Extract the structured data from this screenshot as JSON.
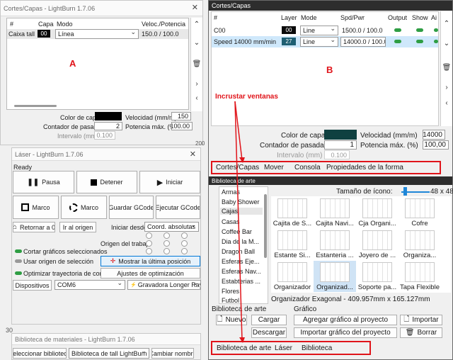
{
  "left": {
    "cuts": {
      "title": "Cortes/Capas - LightBurn 1.7.06",
      "headers": [
        "#",
        "Capa",
        "Modo",
        "Veloc./Potencia"
      ],
      "row": {
        "name": "Caixa tall",
        "layer": "00",
        "mode": "Línea",
        "speed_power": "150.0 / 100.0"
      },
      "marker": "A",
      "layer_color_label": "Color de capa",
      "speed_label": "Velocidad (mm/m)",
      "speed_value": "150",
      "pass_label": "Contador de pasadas",
      "pass_value": "2",
      "power_label": "Potencia máx. (%)",
      "power_value": "100.00",
      "interval_label": "Intervalo (mm)",
      "interval_value": "0.100",
      "ruler_value": "200"
    },
    "laser": {
      "title": "Láser - LightBurn 1.7.06",
      "status": "Ready",
      "buttons": {
        "pause": "Pausa",
        "stop": "Detener",
        "start": "Iniciar",
        "frame1": "Marco",
        "frame2": "Marco",
        "save_gcode": "Guardar GCode",
        "run_gcode": "Ejecutar GCode",
        "home": "Retornar a 0",
        "goto_origin": "Ir al origen",
        "show_last": "Mostrar la última posición",
        "opt_settings": "Ajustes de optimización",
        "devices": "Dispositivos"
      },
      "start_from_label": "Iniciar desde:",
      "start_from_value": "Coord. absolutas",
      "job_origin_label": "Origen del trabajo",
      "cut_selected": "Cortar gráficos seleccionados",
      "use_selection_origin": "Usar origen de selección",
      "optimize_path": "Optimizar trayectoria de corte",
      "port": "COM6",
      "device": "Gravadora Longer Ray"
    },
    "ruler_value": "30",
    "library": {
      "title": "Biblioteca de materiales - LightBurn 1.7.06",
      "select_label": "Seleccionar biblioteca",
      "library_value": "Biblioteca de tall LightBurn",
      "rename_label": "Cambiar nombre"
    }
  },
  "right": {
    "cuts": {
      "title": "Cortes/Capas",
      "headers": [
        "#",
        "Layer",
        "Mode",
        "Spd/Pwr",
        "Output",
        "Show",
        "Ai"
      ],
      "rows": [
        {
          "name": "C00",
          "layer": "00",
          "mode": "Line",
          "spd": "1500.0 / 100.0"
        },
        {
          "name": "Speed 14000 mm/min",
          "layer": "27",
          "mode": "Line",
          "spd": "14000.0 / 100.0"
        }
      ],
      "marker": "B",
      "annotation": "Incrustar ventanas",
      "layer_color_label": "Color de capa",
      "speed_label": "Velocidad (mm/m)",
      "speed_value": "14000",
      "pass_label": "Contador de pasadas",
      "pass_value": "1",
      "power_label": "Potencia máx. (%)",
      "power_value": "100,00",
      "interval_label": "Intervalo (mm)",
      "interval_value": "0.100",
      "tabs": [
        "Cortes/Capas",
        "Mover",
        "Consola",
        "Propiedades de la forma"
      ]
    },
    "art": {
      "title": "Biblioteca de arte",
      "categories": [
        "Armas",
        "Baby Shower",
        "Cajas",
        "Casas",
        "Coffee Bar",
        "Dia de la M...",
        "Dragon Ball",
        "Esferas Eje...",
        "Esferas Nav...",
        "Estabterias ...",
        "Flores",
        "Futbol"
      ],
      "icon_size_label": "Tamaño de ícono:",
      "icon_size_value": "48 x 48",
      "thumbs": [
        "Cajita de S...",
        "Cajita Navi...",
        "Cja Organi...",
        "Cofre",
        "Estante Si...",
        "Estanteria ...",
        "Joyero de ...",
        "Organiza...",
        "Organizador",
        "Organizad...",
        "Soporte pa...",
        "Tapa Flexible"
      ],
      "status": "Organizador Exagonal - 409.957mm x 165.127mm",
      "section_library": "Biblioteca de arte",
      "section_graphic": "Gráfico",
      "buttons": {
        "new": "Nuevo",
        "load": "Cargar",
        "download": "Descargar",
        "add_to_project": "Agregar gráfico al proyecto",
        "import_to_project": "Importar gráfico del proyecto",
        "import": "Importar",
        "delete": "Borrar"
      },
      "bottom_tabs": [
        "Biblioteca de arte",
        "Láser",
        "Biblioteca"
      ]
    }
  },
  "colors": {
    "accent_red": "#e0141a",
    "layer00": "#0a0a0a",
    "layer27": "#1e5f73",
    "dark_swatch": "#0f4040",
    "selected_row": "#cfe8fb"
  }
}
